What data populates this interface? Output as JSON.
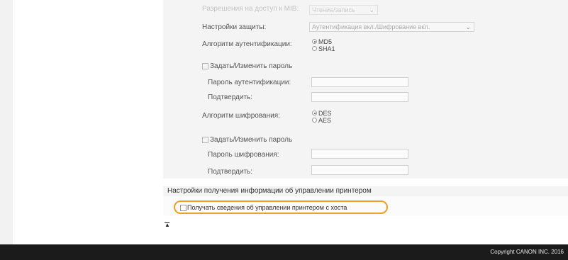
{
  "snmp": {
    "access_permissions_label": "Разрешения на доступ к MIB:",
    "access_permissions_value": "Чтение/запись",
    "security_settings_label": "Настройки защиты:",
    "security_settings_value": "Аутентификация вкл./Шифрование вкл.",
    "auth_algorithm_label": "Алгоритм аутентификации:",
    "auth_algorithm_options": [
      "MD5",
      "SHA1"
    ],
    "auth_algorithm_selected": "MD5",
    "set_auth_password_label": "Задать/Изменить пароль",
    "auth_password_label": "Пароль аутентификации:",
    "auth_confirm_label": "Подтвердить:",
    "encryption_algorithm_label": "Алгоритм шифрования:",
    "encryption_algorithm_options": [
      "DES",
      "AES"
    ],
    "encryption_algorithm_selected": "DES",
    "set_encryption_password_label": "Задать/Изменить пароль",
    "encryption_password_label": "Пароль шифрования:",
    "encryption_confirm_label": "Подтвердить:"
  },
  "printer_management": {
    "section_title": "Настройки получения информации об управлении принтером",
    "get_from_host_label": "Получать сведения об управлении принтером с хоста",
    "get_from_host_checked": false,
    "highlight_color": "#f0a020"
  },
  "footer": {
    "copyright": "Copyright CANON INC. 2016"
  },
  "icons": {
    "scroll_top": "scroll-to-top-icon",
    "dropdown": "chevron-down-icon"
  }
}
